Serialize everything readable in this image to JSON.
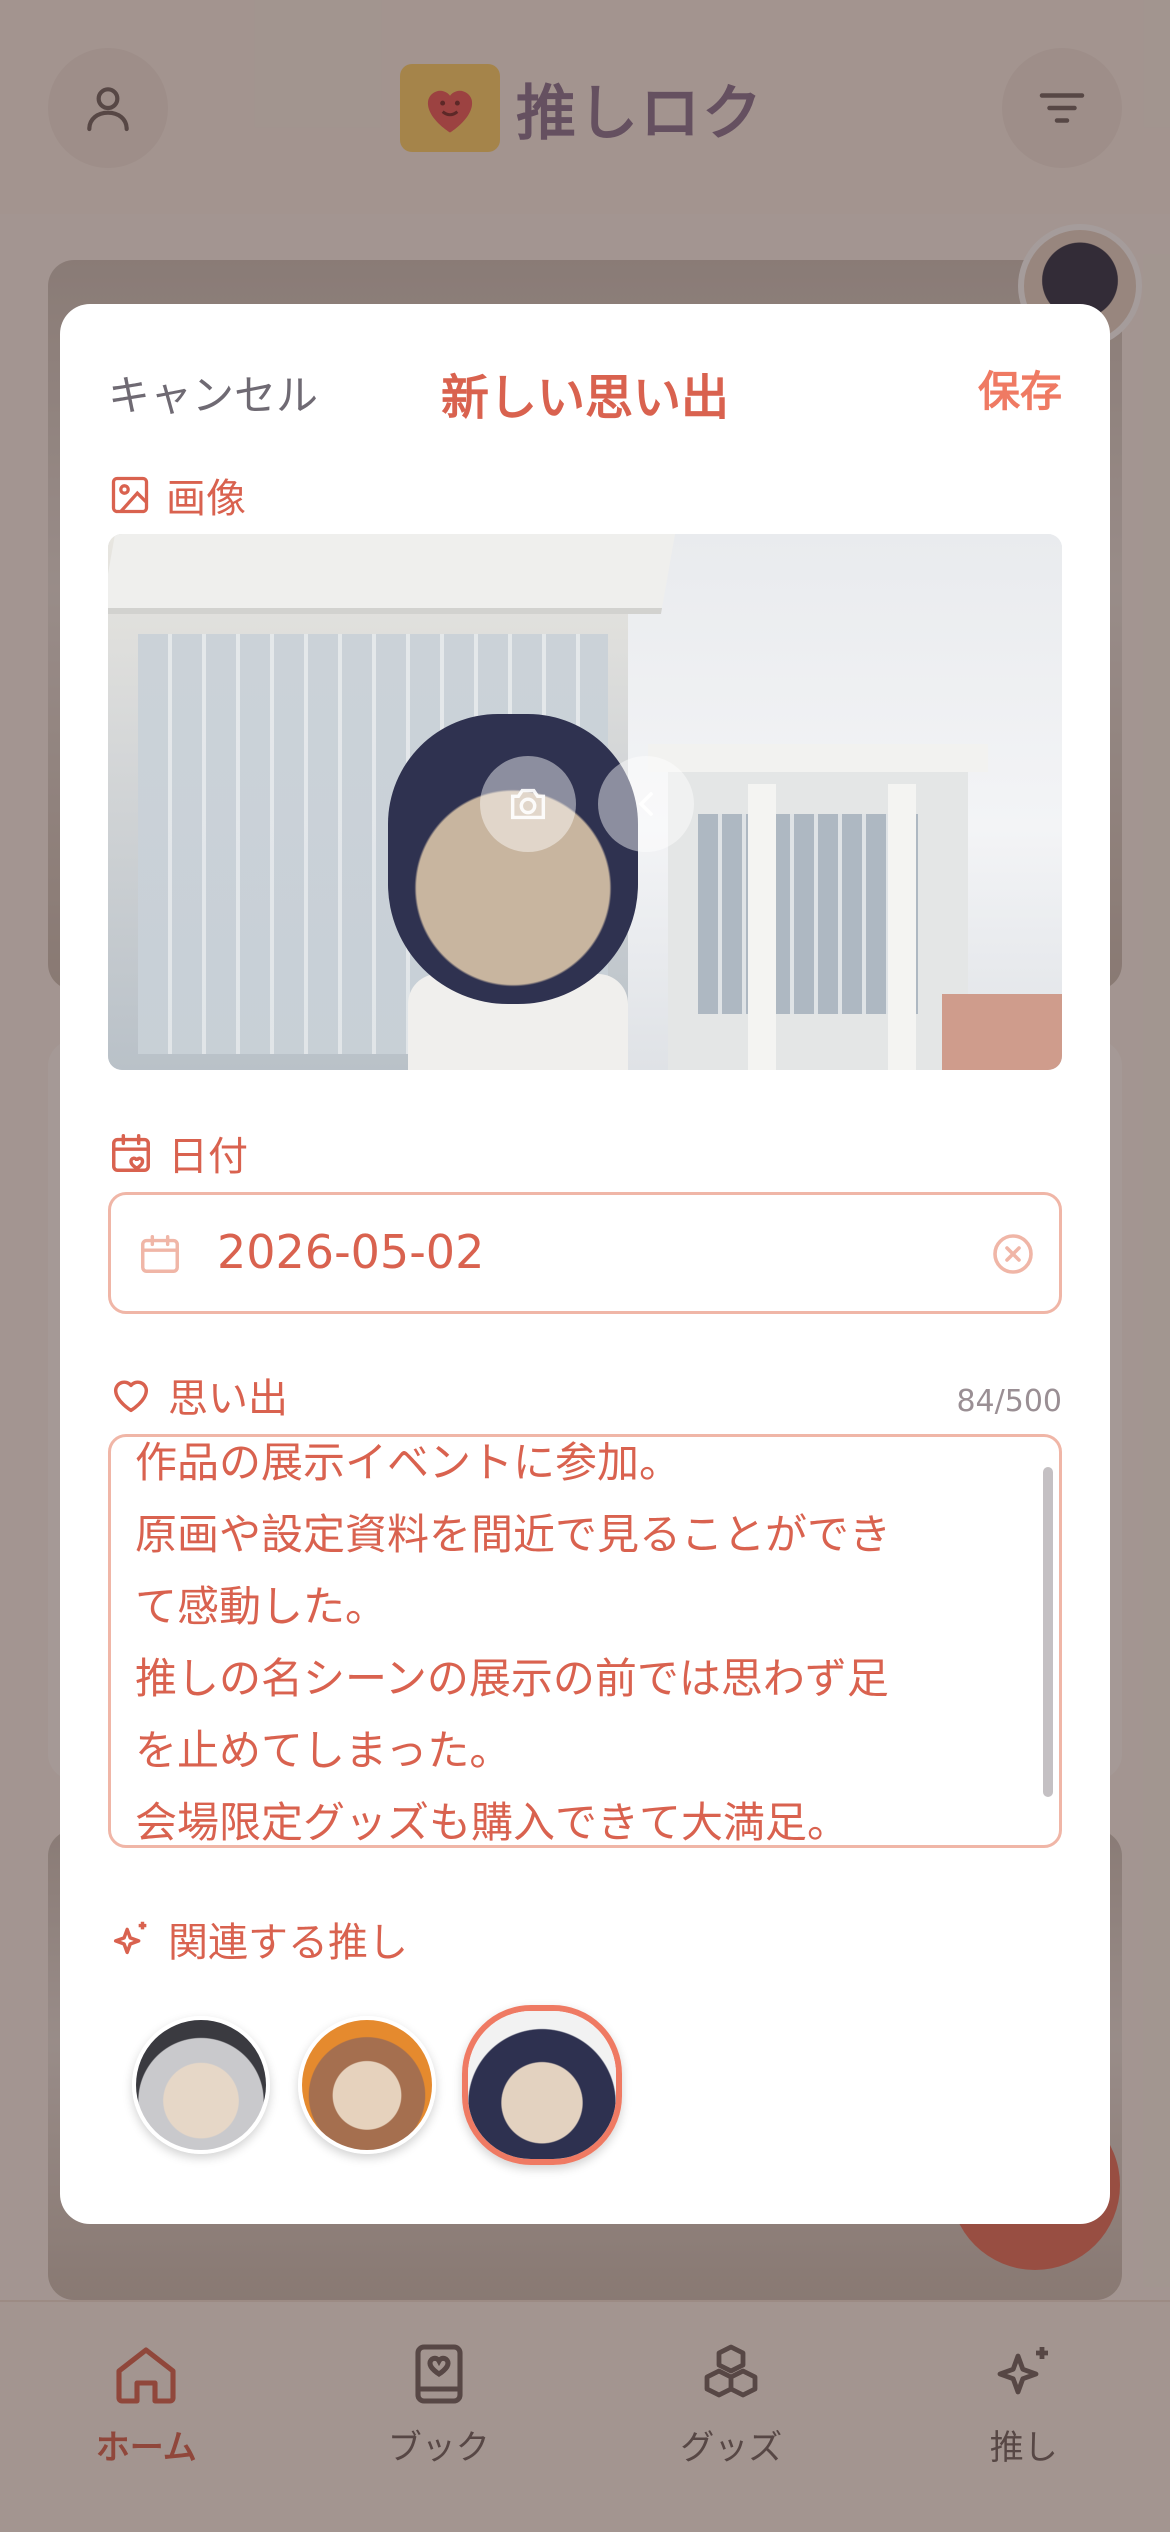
{
  "app": {
    "title": "推しロク",
    "logo_icon": "heart-book-icon",
    "profile_icon": "user-icon",
    "filter_icon": "sort-lines-icon"
  },
  "tabs": [
    {
      "label": "ホーム",
      "icon": "home-icon",
      "active": true
    },
    {
      "label": "ブック",
      "icon": "book-icon",
      "active": false
    },
    {
      "label": "グッズ",
      "icon": "cubes-icon",
      "active": false
    },
    {
      "label": "推し",
      "icon": "sparkles-icon",
      "active": false
    }
  ],
  "modal": {
    "cancel_label": "キャンセル",
    "title": "新しい思い出",
    "save_label": "保存",
    "image": {
      "label": "画像",
      "camera_button_icon": "camera-icon",
      "remove_button_icon": "close-icon"
    },
    "date": {
      "label": "日付",
      "value": "2026-05-02"
    },
    "memory": {
      "label": "思い出",
      "count": "84/500",
      "lines": [
        "作品の展示イベントに参加。",
        "原画や設定資料を間近で見ることができ",
        "て感動した。",
        "推しの名シーンの展示の前では思わず足",
        "を止めてしまった。",
        "会場限定グッズも購入できて大満足。"
      ]
    },
    "related": {
      "label": "関連する推し",
      "oshi": [
        {
          "name": "oshi-silver-hair",
          "selected": false
        },
        {
          "name": "oshi-brown-hair",
          "selected": false
        },
        {
          "name": "oshi-navy-hair",
          "selected": true
        }
      ]
    }
  },
  "colors": {
    "accent": "#d9624f",
    "accent_light": "#ef7a63",
    "border": "#f0b6a7",
    "muted": "#6f6a73"
  }
}
